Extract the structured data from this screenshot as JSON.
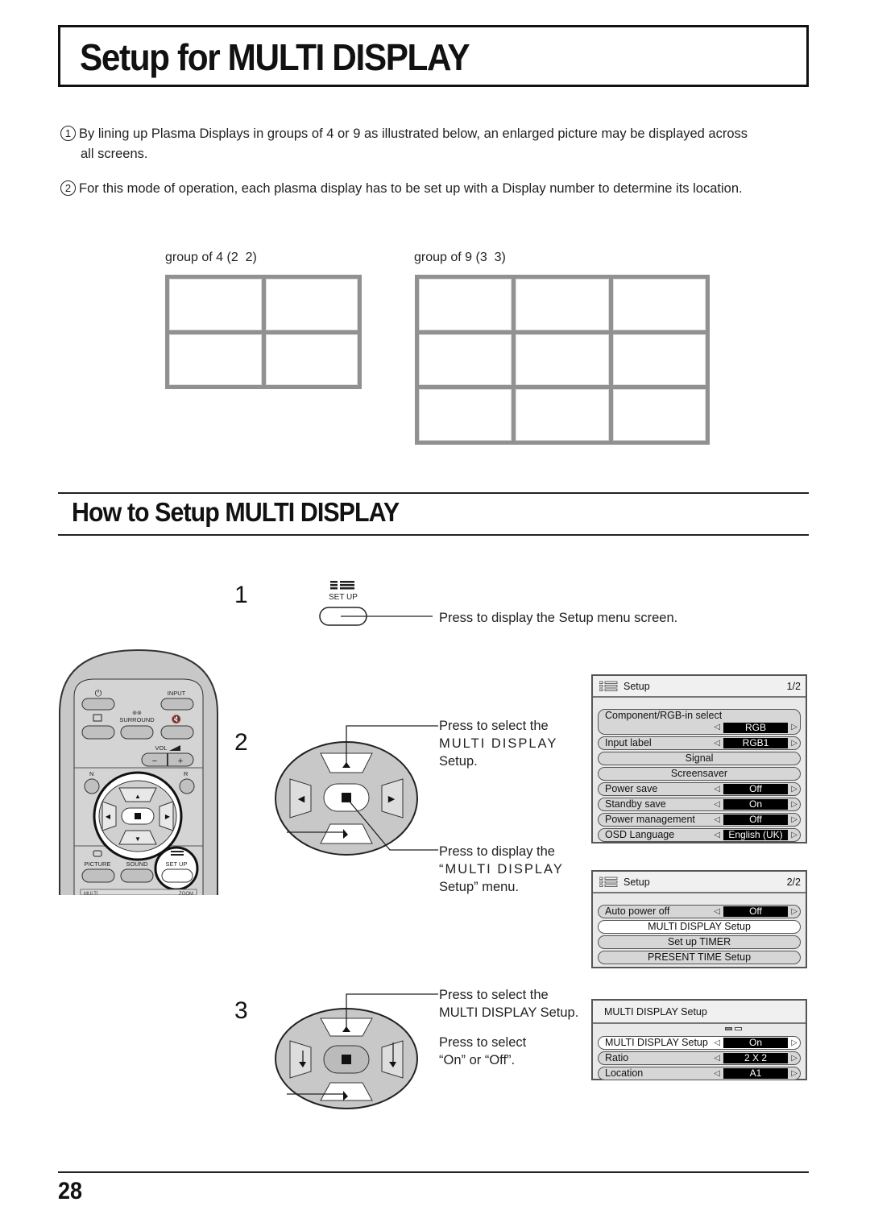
{
  "page": {
    "title": "Setup for MULTI DISPLAY",
    "page_number": "28"
  },
  "intro": {
    "items": [
      {
        "marker": "1",
        "text_line1": "By lining up Plasma Displays in groups of 4 or 9 as illustrated below, an enlarged picture may be displayed across",
        "text_line2": "all screens."
      },
      {
        "marker": "2",
        "text": "For this mode of operation, each plasma display has to be set up with a Display number to determine its location."
      }
    ]
  },
  "groups": [
    {
      "label": "group of 4 (2  2)",
      "rows": 2,
      "cols": 2
    },
    {
      "label": "group of 9 (3  3)",
      "rows": 3,
      "cols": 3
    }
  ],
  "section": {
    "title": "How to Setup MULTI DISPLAY"
  },
  "steps": {
    "step1": {
      "number": "1",
      "button_label": "SET UP",
      "button_icon": "setup-menu-icon",
      "callout": "Press to display the Setup menu screen."
    },
    "step2": {
      "number": "2",
      "callout1": [
        "Press to select the",
        "MULTI DISPLAY",
        "Setup."
      ],
      "callout2": [
        "Press to display the",
        "“MULTI DISPLAY",
        "Setup” menu."
      ]
    },
    "step3": {
      "number": "3",
      "callout1": [
        "Press to select the",
        "MULTI DISPLAY Setup."
      ],
      "callout2": [
        "Press to select",
        "“On” or “Off”."
      ]
    }
  },
  "remote": {
    "labels": {
      "power": "⏻",
      "input": "INPUT",
      "surround": "SURROUND",
      "surround_icon": "⊚⊚",
      "vol": "VOL",
      "minus": "−",
      "plus": "+",
      "n": "N",
      "r": "R",
      "picture": "PICTURE",
      "sound": "SOUND",
      "setup": "SET UP",
      "multi": "MULTI",
      "zoom": "ZOOM"
    }
  },
  "dpad": {
    "up": "▲",
    "down": "▼",
    "left": "◀",
    "right": "▶",
    "center": "■"
  },
  "osd_setup_1": {
    "title": "Setup",
    "page": "1/2",
    "rows": [
      {
        "label": "Component/RGB-in  select",
        "value": "RGB"
      },
      {
        "label": "Input label",
        "value": "RGB1"
      },
      {
        "label": "Signal"
      },
      {
        "label": "Screensaver"
      },
      {
        "label": "Power save",
        "value": "Off"
      },
      {
        "label": "Standby save",
        "value": "On"
      },
      {
        "label": "Power management",
        "value": "Off"
      },
      {
        "label": "OSD  Language",
        "value": "English (UK)"
      }
    ]
  },
  "osd_setup_2": {
    "title": "Setup",
    "page": "2/2",
    "rows": [
      {
        "label": "Auto power off",
        "value": "Off"
      },
      {
        "label": "MULTI DISPLAY Setup",
        "selected": true
      },
      {
        "label": "Set up TIMER"
      },
      {
        "label": "PRESENT  TIME  Setup"
      }
    ]
  },
  "osd_multi": {
    "title": "MULTI DISPLAY Setup",
    "rows": [
      {
        "label": "MULTI DISPLAY Setup",
        "value": "On",
        "selected": true
      },
      {
        "label": "Ratio",
        "value": "2 X 2"
      },
      {
        "label": "Location",
        "value": "A1"
      }
    ]
  },
  "arrows": {
    "left": "◁",
    "right": "▷"
  }
}
